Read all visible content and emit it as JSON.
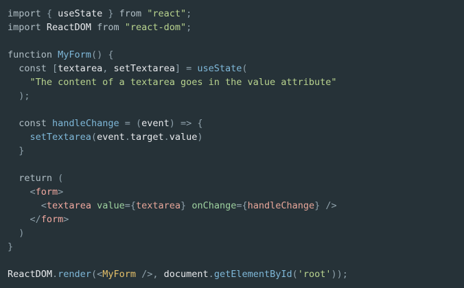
{
  "colors": {
    "background": "#263238",
    "keyword": "#b0bec5",
    "plain": "#e8eaed",
    "punct": "#8fa1ab",
    "string": "#b9d48f",
    "function": "#7fb8d9",
    "component": "#e6c16a",
    "tag": "#f1a9a0",
    "attr": "#9fd3a0",
    "jsx_var": "#e8a79a"
  },
  "code": {
    "lines": [
      [
        [
          "keyword",
          "import"
        ],
        [
          "punct",
          " { "
        ],
        [
          "plain",
          "useState"
        ],
        [
          "punct",
          " } "
        ],
        [
          "keyword",
          "from"
        ],
        [
          "punct",
          " "
        ],
        [
          "string",
          "\"react\""
        ],
        [
          "punct",
          ";"
        ]
      ],
      [
        [
          "keyword",
          "import"
        ],
        [
          "plain",
          " ReactDOM "
        ],
        [
          "keyword",
          "from"
        ],
        [
          "punct",
          " "
        ],
        [
          "string",
          "\"react-dom\""
        ],
        [
          "punct",
          ";"
        ]
      ],
      [],
      [
        [
          "keyword",
          "function"
        ],
        [
          "plain",
          " "
        ],
        [
          "function",
          "MyForm"
        ],
        [
          "punct",
          "() {"
        ]
      ],
      [
        [
          "plain",
          "  "
        ],
        [
          "keyword",
          "const"
        ],
        [
          "punct",
          " ["
        ],
        [
          "plain",
          "textarea"
        ],
        [
          "punct",
          ", "
        ],
        [
          "plain",
          "setTextarea"
        ],
        [
          "punct",
          "] = "
        ],
        [
          "function",
          "useState"
        ],
        [
          "punct",
          "("
        ]
      ],
      [
        [
          "plain",
          "    "
        ],
        [
          "string",
          "\"The content of a textarea goes in the value attribute\""
        ]
      ],
      [
        [
          "punct",
          "  );"
        ]
      ],
      [],
      [
        [
          "plain",
          "  "
        ],
        [
          "keyword",
          "const"
        ],
        [
          "plain",
          " "
        ],
        [
          "function",
          "handleChange"
        ],
        [
          "punct",
          " = ("
        ],
        [
          "plain",
          "event"
        ],
        [
          "punct",
          ") => {"
        ]
      ],
      [
        [
          "plain",
          "    "
        ],
        [
          "function",
          "setTextarea"
        ],
        [
          "punct",
          "("
        ],
        [
          "plain",
          "event"
        ],
        [
          "punct",
          "."
        ],
        [
          "plain",
          "target"
        ],
        [
          "punct",
          "."
        ],
        [
          "plain",
          "value"
        ],
        [
          "punct",
          ")"
        ]
      ],
      [
        [
          "punct",
          "  }"
        ]
      ],
      [],
      [
        [
          "plain",
          "  "
        ],
        [
          "keyword",
          "return"
        ],
        [
          "punct",
          " ("
        ]
      ],
      [
        [
          "plain",
          "    "
        ],
        [
          "punct",
          "<"
        ],
        [
          "tag",
          "form"
        ],
        [
          "punct",
          ">"
        ]
      ],
      [
        [
          "plain",
          "      "
        ],
        [
          "punct",
          "<"
        ],
        [
          "tag",
          "textarea"
        ],
        [
          "plain",
          " "
        ],
        [
          "attr",
          "value"
        ],
        [
          "punct",
          "={"
        ],
        [
          "jsx_var",
          "textarea"
        ],
        [
          "punct",
          "}"
        ],
        [
          "plain",
          " "
        ],
        [
          "attr",
          "onChange"
        ],
        [
          "punct",
          "={"
        ],
        [
          "jsx_var",
          "handleChange"
        ],
        [
          "punct",
          "} />"
        ]
      ],
      [
        [
          "plain",
          "    "
        ],
        [
          "punct",
          "</"
        ],
        [
          "tag",
          "form"
        ],
        [
          "punct",
          ">"
        ]
      ],
      [
        [
          "punct",
          "  )"
        ]
      ],
      [
        [
          "punct",
          "}"
        ]
      ],
      [],
      [
        [
          "plain",
          "ReactDOM"
        ],
        [
          "punct",
          "."
        ],
        [
          "function",
          "render"
        ],
        [
          "punct",
          "(<"
        ],
        [
          "component",
          "MyForm"
        ],
        [
          "punct",
          " />, "
        ],
        [
          "plain",
          "document"
        ],
        [
          "punct",
          "."
        ],
        [
          "function",
          "getElementById"
        ],
        [
          "punct",
          "("
        ],
        [
          "string",
          "'root'"
        ],
        [
          "punct",
          "));"
        ]
      ]
    ]
  }
}
